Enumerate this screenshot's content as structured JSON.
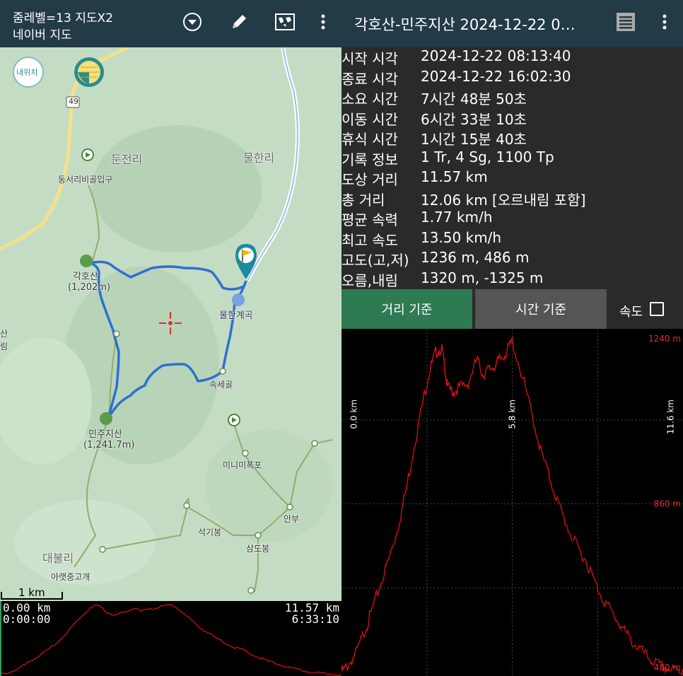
{
  "left_header": {
    "line1": "줌레벨=13 지도X2",
    "line2": "네이버 지도"
  },
  "right_header": {
    "title": "각호산-민주지산 2024-12-22 0…"
  },
  "map": {
    "labels": {
      "naewichi": "내위치",
      "route49": "49",
      "dunjeonri": "둔전리",
      "mulhanri": "물한리",
      "dongseori": "동서리비골입구",
      "gakhosan": "각호산",
      "gakhosan_alt": "(1,202m)",
      "mulhan_valley": "물한계곡",
      "soksegol": "속세골",
      "minjujisan": "민주지산",
      "minjujisan_alt": "(1,241.7m)",
      "minimi_falls": "미니미폭포",
      "anbu": "안부",
      "seokgibong": "석기봉",
      "samdobong": "삼도봉",
      "daebulri": "대불리",
      "araetjung": "아랫중고개",
      "edge1": "산",
      "edge2": "림"
    },
    "scale_label": "1 km"
  },
  "mini_profile": {
    "start_distance": "0.00 km",
    "start_time": "0:00:00",
    "end_distance": "11.57 km",
    "end_time": "6:33:10"
  },
  "stats": [
    {
      "label": "시작 시각",
      "value": "2024-12-22 08:13:40"
    },
    {
      "label": "종료 시각",
      "value": "2024-12-22 16:02:30"
    },
    {
      "label": "소요 시간",
      "value": "7시간 48분 50초"
    },
    {
      "label": "이동 시간",
      "value": "6시간 33분 10초"
    },
    {
      "label": "휴식 시간",
      "value": "1시간 15분 40초"
    },
    {
      "label": "기록 정보",
      "value": "1 Tr, 4 Sg, 1100 Tp"
    },
    {
      "label": "도상 거리",
      "value": "11.57 km"
    },
    {
      "label": "총 거리",
      "value": "12.06 km [오르내림 포함]"
    },
    {
      "label": "평균 속력",
      "value": "1.77 km/h"
    },
    {
      "label": "최고 속도",
      "value": "13.50 km/h"
    },
    {
      "label": "고도(고,저)",
      "value": "1236 m, 486 m"
    },
    {
      "label": "오름,내림",
      "value": "1320 m, -1325 m"
    }
  ],
  "buttons": {
    "distance_basis": "거리 기준",
    "time_basis": "시간 기준",
    "speed_label": "속도",
    "speed_checked": false
  },
  "chart_data": {
    "type": "line",
    "ylim": [
      480,
      1240
    ],
    "xlim": [
      0,
      11.6
    ],
    "ytick_labels": [
      "1240 m",
      "860 m",
      "480 m"
    ],
    "xtick_labels": [
      "0.0 km",
      "5.8 km",
      "11.6 km"
    ],
    "series": [
      {
        "x": [
          0,
          0.2,
          0.5,
          0.8,
          1.0,
          1.3,
          1.6,
          1.9,
          2.2,
          2.5,
          2.8,
          3.0,
          3.2,
          3.4,
          3.5,
          3.6,
          3.8,
          4.0,
          4.3,
          4.6,
          4.8,
          5.0,
          5.2,
          5.4,
          5.6,
          5.8,
          6.2,
          6.5,
          6.8,
          7.1,
          7.4,
          7.7,
          8.0,
          8.3,
          8.6,
          8.9,
          9.2,
          9.5,
          9.8,
          10.1,
          10.4,
          10.7,
          11.0,
          11.3,
          11.6
        ],
        "y": [
          486,
          500,
          530,
          580,
          620,
          680,
          740,
          810,
          900,
          1010,
          1110,
          1170,
          1210,
          1220,
          1180,
          1130,
          1120,
          1130,
          1140,
          1195,
          1160,
          1170,
          1180,
          1195,
          1210,
          1236,
          1140,
          1060,
          980,
          920,
          860,
          810,
          770,
          740,
          690,
          650,
          620,
          590,
          560,
          540,
          520,
          505,
          495,
          490,
          487
        ]
      }
    ],
    "line_color": "#e01010",
    "grid": true
  }
}
